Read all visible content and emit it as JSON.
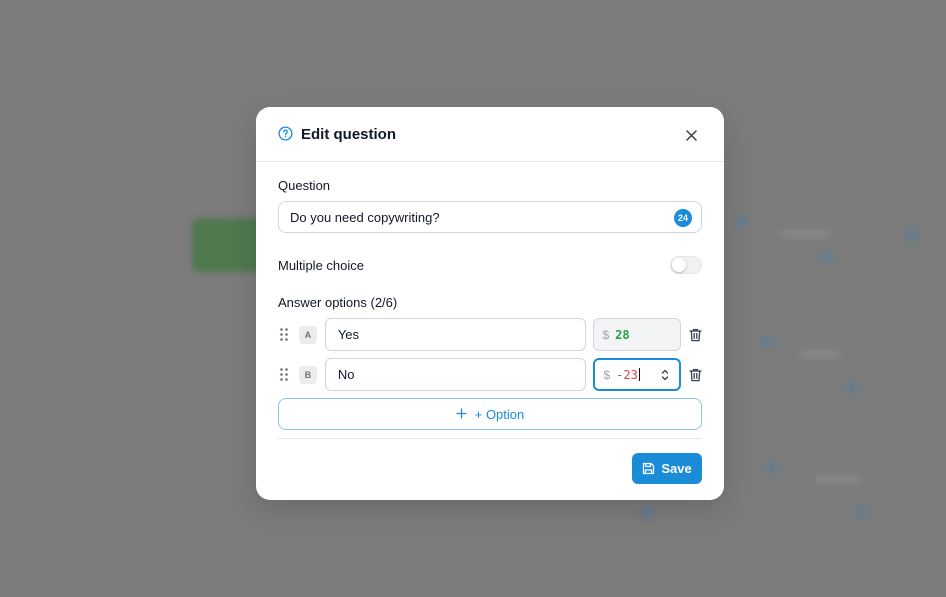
{
  "modal": {
    "title": "Edit question",
    "question_label": "Question",
    "question_value": "Do you need copywriting?",
    "char_count": "24",
    "multiple_choice_label": "Multiple choice",
    "multiple_choice_on": false,
    "answer_options_label": "Answer options (2/6)",
    "options": [
      {
        "letter": "A",
        "text": "Yes",
        "currency": "$",
        "price": "28"
      },
      {
        "letter": "B",
        "text": "No",
        "currency": "$",
        "price": "-23"
      }
    ],
    "add_option_label": "+ Option",
    "save_label": "Save"
  },
  "colors": {
    "accent": "#1a8cd8",
    "positive": "#22a04b",
    "negative": "#d64545"
  },
  "icons": [
    "help-circle-icon",
    "close-icon",
    "drag-handle-icon",
    "trash-icon",
    "plus-icon",
    "save-icon",
    "stepper-icon"
  ]
}
